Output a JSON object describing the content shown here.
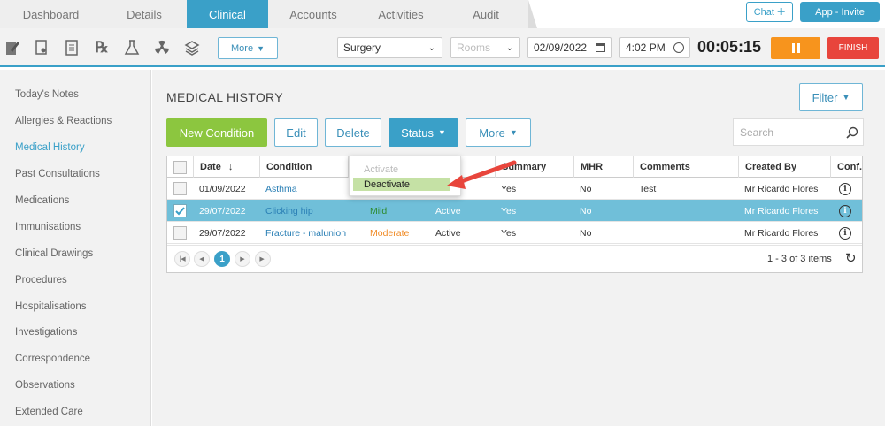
{
  "tabs": [
    "Dashboard",
    "Details",
    "Clinical",
    "Accounts",
    "Activities",
    "Audit"
  ],
  "top": {
    "chat_label": "Chat",
    "invite_label": "App - Invite"
  },
  "toolbar": {
    "icons": [
      "notes-icon",
      "document-icon",
      "form-icon",
      "prescription-icon",
      "lab-icon",
      "radiation-icon",
      "stack-icon"
    ],
    "more_label": "More",
    "location": "Surgery",
    "rooms_placeholder": "Rooms",
    "date": "02/09/2022",
    "time": "4:02 PM",
    "timer": "00:05:15",
    "finish_label": "FINISH"
  },
  "sidebar": {
    "items": [
      "Today's Notes",
      "Allergies & Reactions",
      "Medical History",
      "Past Consultations",
      "Medications",
      "Immunisations",
      "Clinical Drawings",
      "Procedures",
      "Hospitalisations",
      "Investigations",
      "Correspondence",
      "Observations",
      "Extended Care"
    ],
    "active": "Medical History"
  },
  "main": {
    "title": "MEDICAL HISTORY",
    "filter_label": "Filter",
    "buttons": {
      "new": "New Condition",
      "edit": "Edit",
      "delete": "Delete",
      "status": "Status",
      "more": "More"
    },
    "search_placeholder": "Search"
  },
  "status_menu": {
    "items": [
      "Activate",
      "Deactivate"
    ]
  },
  "grid": {
    "columns": [
      "Date",
      "Condition",
      "",
      "",
      "Summary",
      "MHR",
      "Comments",
      "Created By",
      "Conf."
    ],
    "rows": [
      {
        "date": "01/09/2022",
        "condition": "Asthma",
        "severity": "",
        "status": "",
        "summary": "Yes",
        "mhr": "No",
        "comments": "Test",
        "created_by": "Mr Ricardo Flores",
        "selected": false
      },
      {
        "date": "29/07/2022",
        "condition": "Clicking hip",
        "severity": "Mild",
        "status": "Active",
        "summary": "Yes",
        "mhr": "No",
        "comments": "",
        "created_by": "Mr Ricardo Flores",
        "selected": true
      },
      {
        "date": "29/07/2022",
        "condition": "Fracture - malunion",
        "severity": "Moderate",
        "status": "Active",
        "summary": "Yes",
        "mhr": "No",
        "comments": "",
        "created_by": "Mr Ricardo Flores",
        "selected": false
      }
    ],
    "pager": {
      "current": "1",
      "summary": "1 - 3 of 3 items"
    }
  },
  "colors": {
    "accent": "#3aa0c8",
    "green": "#8cc63f",
    "orange": "#f7941d",
    "red": "#e8453c",
    "mild": "#2e8b2e",
    "moderate": "#f08a24"
  }
}
